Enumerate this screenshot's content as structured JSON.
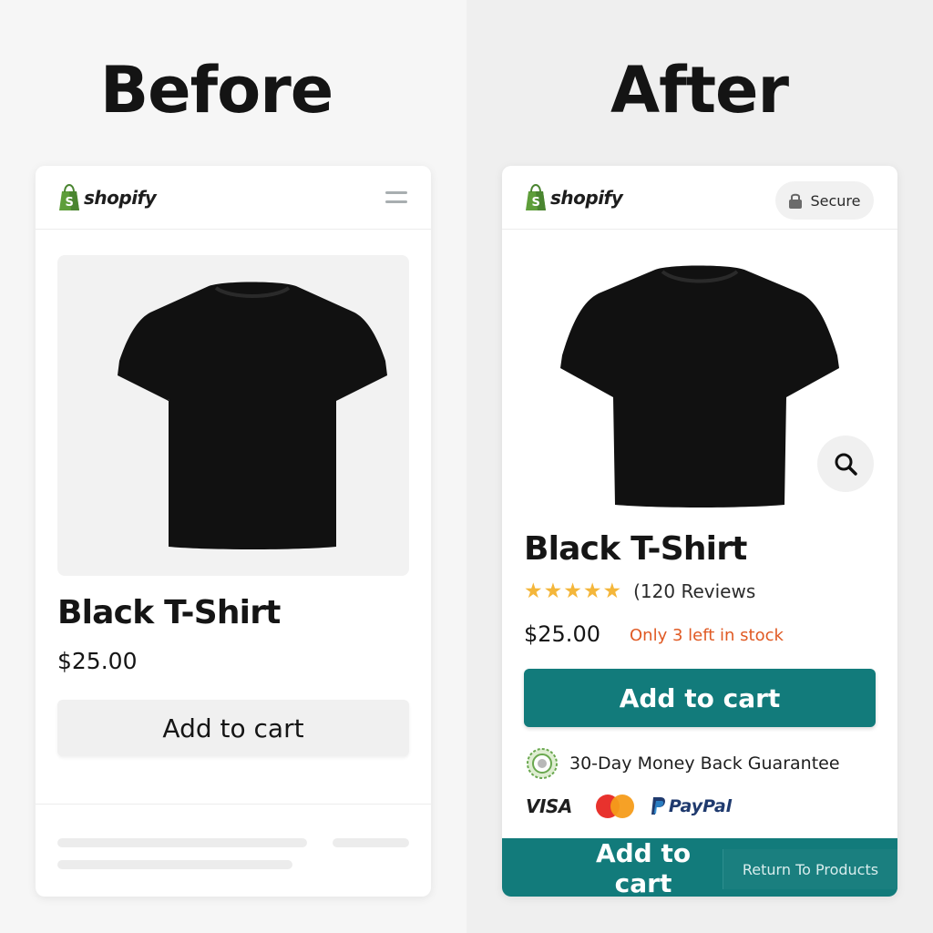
{
  "headings": {
    "before": "Before",
    "after": "After"
  },
  "brand": {
    "name": "shopify",
    "logo_icon": "shopify-bag-icon",
    "color": "#5e9e3a"
  },
  "before": {
    "menu_icon": "hamburger-menu-icon",
    "product": {
      "title": "Black T-Shirt",
      "price": "$25.00"
    },
    "add_to_cart_label": "Add to cart"
  },
  "after": {
    "secure_badge": {
      "label": "Secure",
      "icon": "lock-icon"
    },
    "zoom_icon": "search-icon",
    "product": {
      "title": "Black T-Shirt",
      "rating_stars": 5,
      "reviews_label": "(120 Reviews",
      "price": "$25.00",
      "stock_notice": "Only 3 left in stock"
    },
    "add_to_cart_label": "Add to cart",
    "guarantee": {
      "label": "30-Day Money Back Guarantee",
      "icon": "guarantee-seal-icon"
    },
    "payment_methods": {
      "visa": "VISA",
      "mastercard_icon": "mastercard-icon",
      "paypal": "PayPal"
    },
    "sticky_bar": {
      "add_to_cart_label": "Add to cart",
      "return_label": "Return To Products"
    }
  },
  "colors": {
    "accent": "#127b7b",
    "stock_warning": "#e05a24",
    "star": "#f4b63a",
    "before_button_bg": "#f0f0f0"
  }
}
